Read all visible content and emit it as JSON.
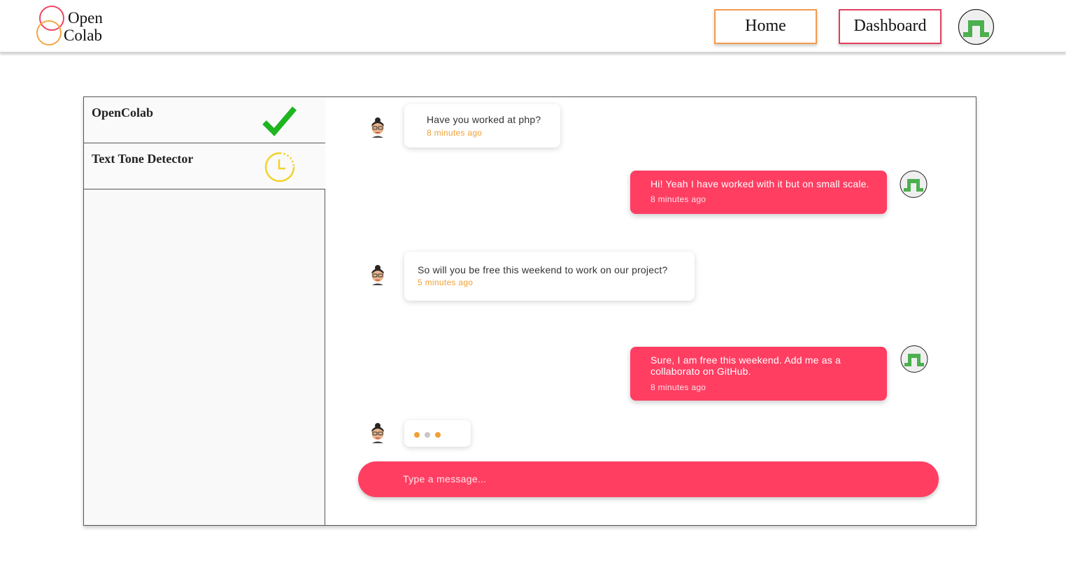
{
  "brand": {
    "line1": "Open",
    "line2": "Colab",
    "ring_colors": [
      "#f0445f",
      "#f5a640"
    ]
  },
  "nav": {
    "home": "Home",
    "dashboard": "Dashboard",
    "home_border": "#f39a4e",
    "dashboard_border": "#e2405f"
  },
  "projects": [
    {
      "name": "OpenColab",
      "status_icon": "checkmark-icon",
      "status_color": "#1fb51f"
    },
    {
      "name": "Text Tone Detector",
      "status_icon": "clock-icon",
      "status_color": "#f2d22a"
    }
  ],
  "messages": [
    {
      "side": "in",
      "text": "Have you worked at php?",
      "time": "8 minutes ago"
    },
    {
      "side": "out",
      "text": "Hi! Yeah I have worked with it but on small scale.",
      "time": "8 minutes ago"
    },
    {
      "side": "in",
      "text": "So will you be free this weekend to work on our project?",
      "time": "5 minutes ago"
    },
    {
      "side": "out",
      "text": "Sure, I am free this weekend. Add me as a collaborato on GitHub.",
      "time": "8 minutes ago"
    }
  ],
  "typing_indicator": {
    "dot_colors": [
      "#f0a035",
      "#c7c7c7",
      "#f0a035"
    ]
  },
  "composer": {
    "placeholder": "Type a message..."
  },
  "colors": {
    "accent": "#ff3e62",
    "timestamp": "#f0a035",
    "avatar_green": "#4caf50"
  }
}
